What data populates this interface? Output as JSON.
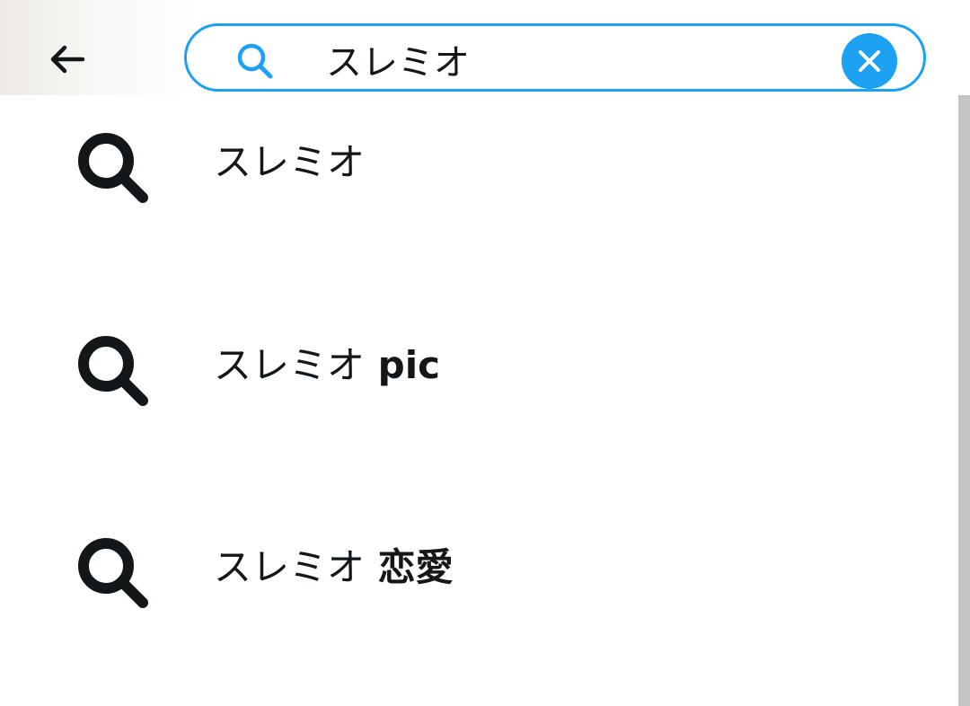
{
  "search": {
    "query": "スレミオ",
    "placeholder": ""
  },
  "icons": {
    "back": "arrow-left-icon",
    "search": "search-icon",
    "clear": "close-icon",
    "suggestion": "search-icon"
  },
  "colors": {
    "accent": "#1da1f2",
    "text": "#14171a",
    "scrollbar": "#c4c4c4"
  },
  "suggestions": [
    {
      "prefix": "スレミオ",
      "suffix": ""
    },
    {
      "prefix": "スレミオ",
      "suffix": " pic"
    },
    {
      "prefix": "スレミオ",
      "suffix": " 恋愛"
    }
  ]
}
